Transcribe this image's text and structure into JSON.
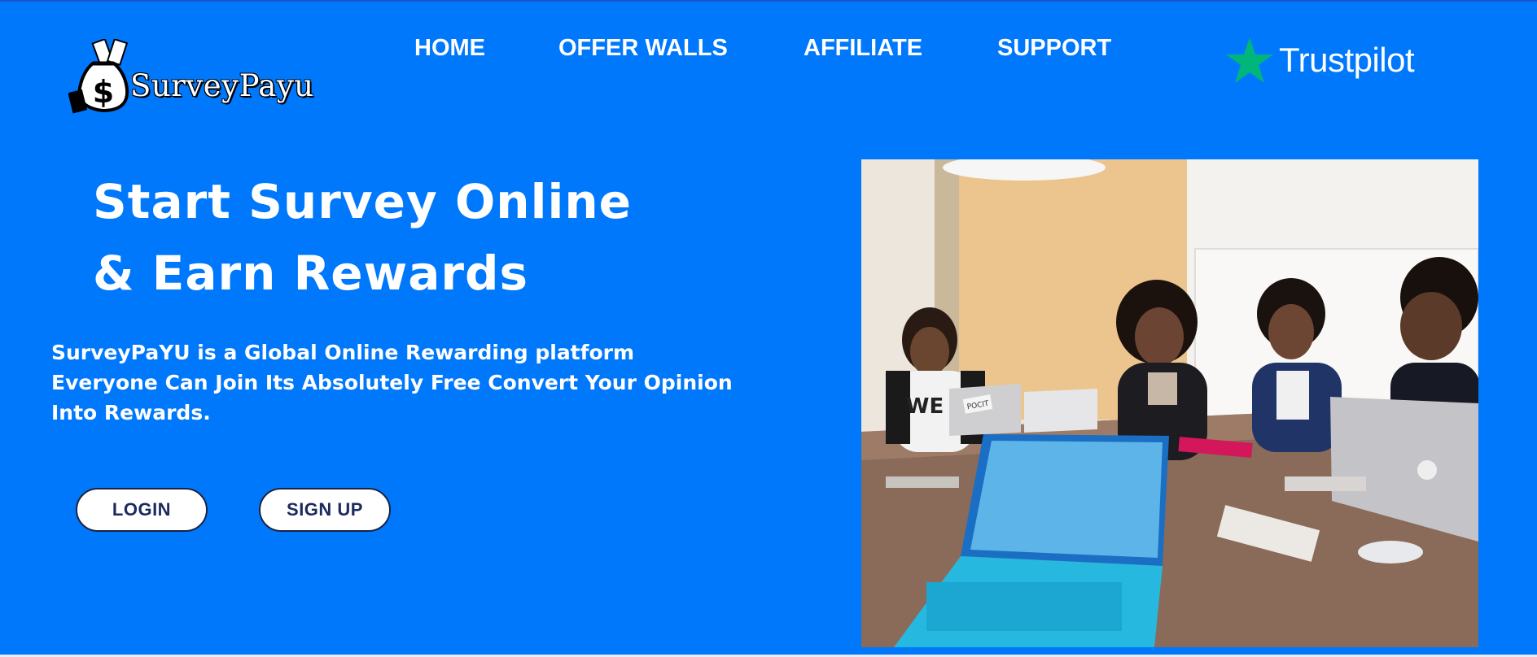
{
  "brand": {
    "name": "SurveyPayu",
    "logo_icon": "money-bag-icon"
  },
  "nav": {
    "items": [
      {
        "label": "HOME"
      },
      {
        "label": "OFFER WALLS"
      },
      {
        "label": "AFFILIATE"
      },
      {
        "label": "SUPPORT"
      }
    ]
  },
  "trustpilot": {
    "label": "Trustpilot",
    "icon": "star-icon"
  },
  "hero": {
    "title_line1": "Start Survey Online",
    "title_line2": "& Earn Rewards",
    "description": "SurveyPaYU is a Global Online Rewarding platform Everyone Can Join Its Absolutely Free Convert Your Opinion Into Rewards.",
    "image_sticker_text": "POCIT",
    "image_shirt_text": "WE"
  },
  "buttons": {
    "login": "LOGIN",
    "signup": "SIGN UP"
  },
  "colors": {
    "background": "#0078fc",
    "trustpilot_star": "#00b67a",
    "button_text": "#1c2a5e",
    "white": "#ffffff"
  }
}
